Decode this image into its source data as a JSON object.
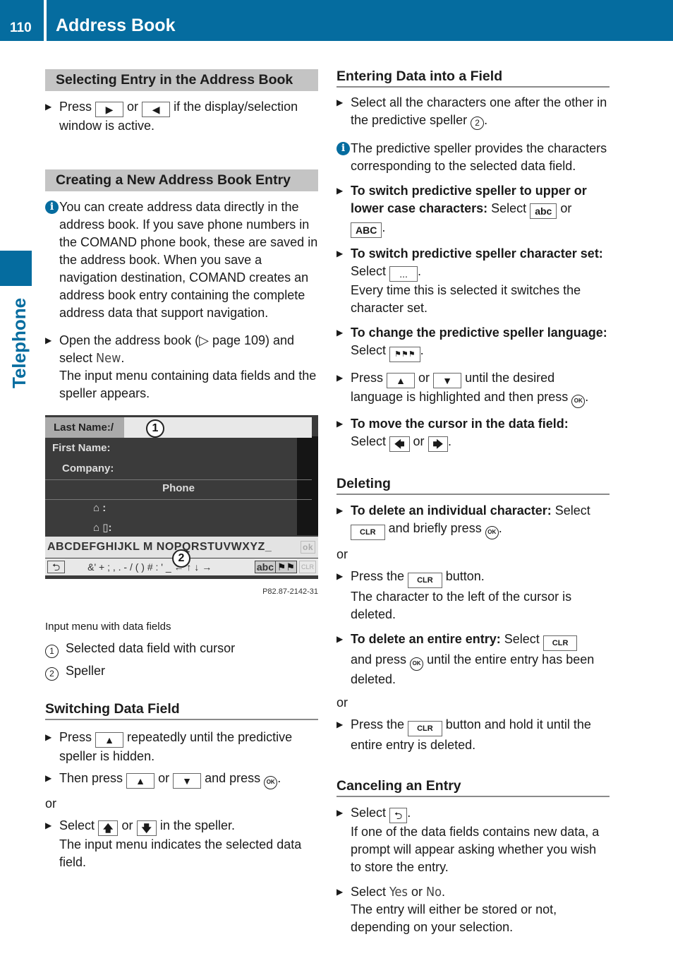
{
  "header": {
    "page_number": "110",
    "chapter_title": "Address Book"
  },
  "side_tab": {
    "label": "Telephone"
  },
  "left": {
    "s1": {
      "title": "Selecting Entry in the Address Book",
      "step_pre": "Press",
      "key_right": "▶",
      "or": "or",
      "key_left": "◀",
      "step_post": "if the display/selection window is active."
    },
    "s2": {
      "title": "Creating a New Address Book Entry",
      "info": "You can create address data directly in the address book. If you save phone numbers in the COMAND phone book, these are saved in the address book. When you save a navigation destination, COMAND creates an address book entry containing the complete address data that support navigation.",
      "step_pre": "Open the address book (▷ page 109) and select",
      "step_menu": "New",
      "step_post": ".",
      "step_result": "The input menu containing data fields and the speller appears."
    },
    "figure": {
      "rows": [
        "Last Name:/",
        "First Name:",
        "Company:",
        "Phone",
        "⌂  :",
        "⌂ ▯:"
      ],
      "speller_letters": "ABCDEFGHIJKL M NOPQRSTUVWXYZ_",
      "speller_ok": "ok",
      "speller_symbols": "&' + ; , . - / ( ) # : ' _ ← ↑ ↓ →",
      "speller_abc": "abc",
      "speller_dots": "...",
      "speller_clr": "CLR",
      "callout_1": "1",
      "callout_2": "2",
      "code": "P82.87-2142-31"
    },
    "caption": "Input menu with data fields",
    "legend": [
      {
        "num": "1",
        "text": "Selected data field with cursor"
      },
      {
        "num": "2",
        "text": "Speller"
      }
    ],
    "s3": {
      "title": "Switching Data Field",
      "step1_pre": "Press",
      "key_up": "▲",
      "step1_post": "repeatedly until the predictive speller is hidden.",
      "step2_pre": "Then press",
      "or": "or",
      "key_down": "▼",
      "step2_post": "and press",
      "ok": "OK",
      "or_line": "or",
      "step3_pre": "Select",
      "arrow_up": "🡅",
      "arrow_down": "🡇",
      "step3_post": "in the speller.",
      "step3_result": "The input menu indicates the selected data field."
    }
  },
  "right": {
    "s1": {
      "title": "Entering Data into a Field",
      "step": "Select all the characters one after the other in the predictive speller",
      "callout": "2",
      "info": "The predictive speller provides the characters corresponding to the selected data field.",
      "b1_bold": "To switch predictive speller to upper or lower case characters:",
      "b1_text": "Select",
      "key_abc": "abc",
      "or": "or",
      "key_ABC": "ABC",
      "b2_bold": "To switch predictive speller character set:",
      "b2_text": "Select",
      "key_dots": "...",
      "b2_result": "Every time this is selected it switches the character set.",
      "b3_bold": "To change the predictive speller language:",
      "b3_text": "Select",
      "key_flags": "⚑⚑⚑",
      "b4_pre": "Press",
      "key_up": "▲",
      "key_down": "▼",
      "b4_post": "until the desired language is highlighted and then press",
      "b5_bold": "To move the cursor in the data field:",
      "b5_text": "Select",
      "key_left": "🡄",
      "key_right": "🡆",
      "ok": "OK"
    },
    "s2": {
      "title": "Deleting",
      "b1_bold": "To delete an individual character:",
      "b1_text": "Select",
      "key_clr": "CLR",
      "b1_post": "and briefly press",
      "or": "or",
      "b2_pre": "Press the",
      "b2_post": "button.",
      "b2_result": "The character to the left of the cursor is deleted.",
      "b3_bold": "To delete an entire entry:",
      "b3_text": "Select",
      "b3_post1": "and press",
      "b3_post2": "until the entire entry has been deleted.",
      "b4_pre": "Press the",
      "b4_post": "button and hold it until the entire entry is deleted.",
      "ok": "OK"
    },
    "s3": {
      "title": "Canceling an Entry",
      "b1_pre": "Select",
      "key_back": "⮌",
      "b1_result": "If one of the data fields contains new data, a prompt will appear asking whether you wish to store the entry.",
      "b2_pre": "Select",
      "yes": "Yes",
      "or": "or",
      "no": "No",
      "b2_result": "The entry will either be stored or not, depending on your selection."
    }
  }
}
